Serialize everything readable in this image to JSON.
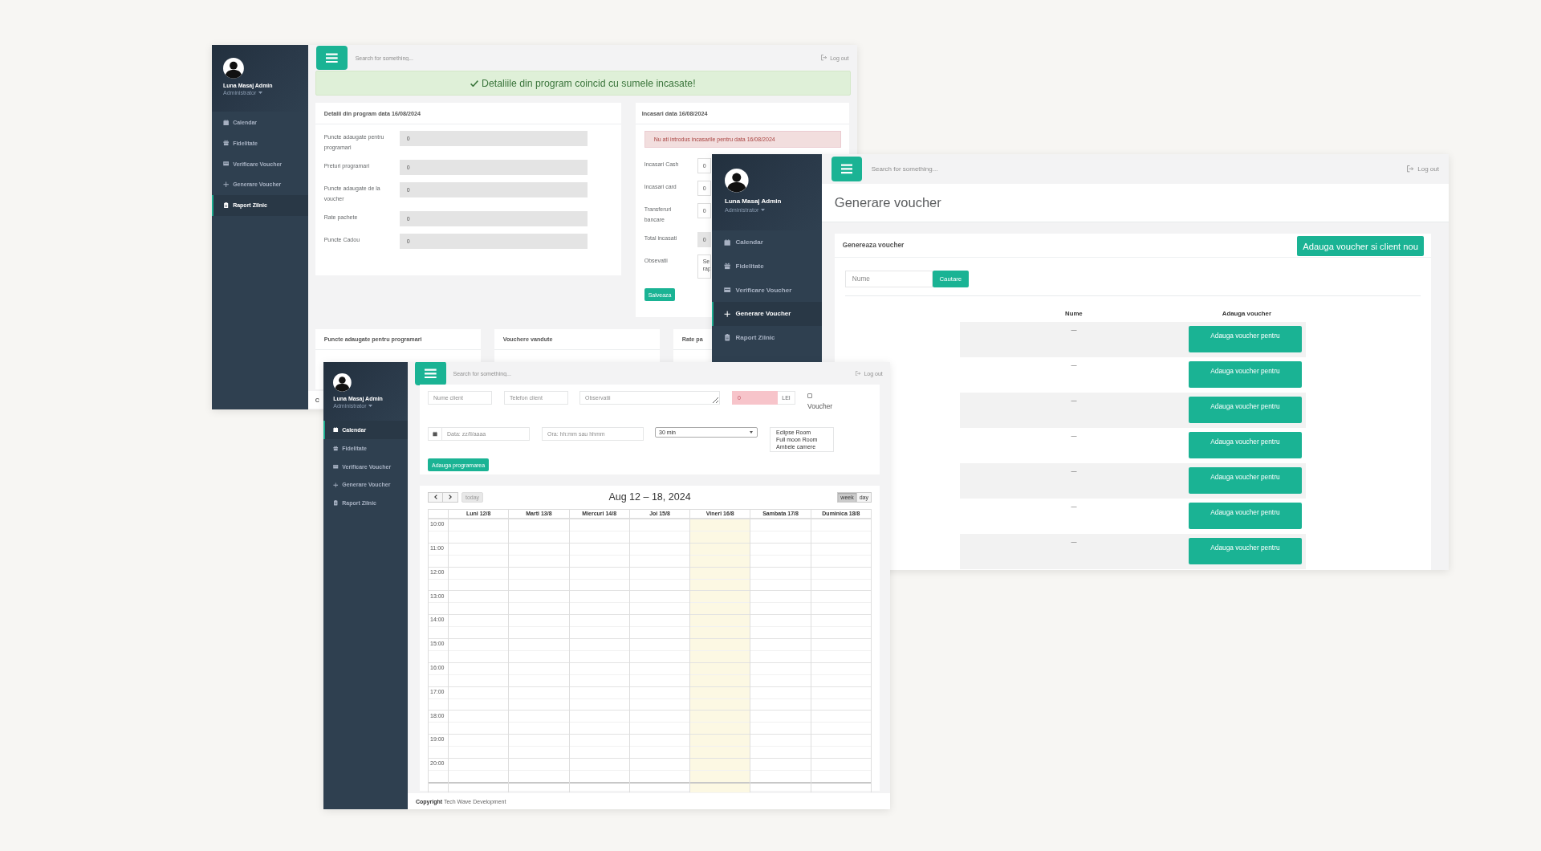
{
  "report_window": {
    "sidebar": {
      "user": "Luna Masaj Admin",
      "role": "Administrator",
      "items": [
        {
          "label": "Calendar",
          "selected": false
        },
        {
          "label": "Fidelitate",
          "selected": false
        },
        {
          "label": "Verificare Voucher",
          "selected": false
        },
        {
          "label": "Generare Voucher",
          "selected": false
        },
        {
          "label": "Raport Zilnic",
          "selected": true
        }
      ]
    },
    "topbar": {
      "search": {
        "placeholder": "Search for something..."
      },
      "logout": "Log out"
    },
    "success_alert": "Detaliile din program coincid cu sumele incasate!",
    "program_card": {
      "title": "Detalii din program data 16/08/2024",
      "fields": [
        {
          "label": "Puncte adaugate pentru programari",
          "value": "0",
          "disabled": true
        },
        {
          "label": "Preturi programari",
          "value": "0",
          "disabled": true
        },
        {
          "label": "Puncte adaugate de la voucher",
          "value": "0",
          "disabled": true
        },
        {
          "label": "Rate pachete",
          "value": "0",
          "disabled": true
        },
        {
          "label": "Puncte Cadou",
          "value": "0",
          "disabled": true
        }
      ]
    },
    "income_card": {
      "title": "Incasari data 16/08/2024",
      "error_alert": "Nu ati introdus incasarile pentru data 16/08/2024",
      "fields": [
        {
          "kind": "input",
          "label": "Incasari Cash",
          "value": "0",
          "disabled": false
        },
        {
          "kind": "input",
          "label": "Incasari card",
          "value": "0",
          "disabled": false
        },
        {
          "kind": "input",
          "label": "Transferuri bancare",
          "value": "0",
          "disabled": false
        },
        {
          "kind": "input",
          "label": "Total incasati",
          "value": "0",
          "disabled": true
        },
        {
          "kind": "textarea",
          "label": "Obsevatii",
          "value": "Se\nrap",
          "disabled": false
        }
      ],
      "save_button": "Salveaza"
    },
    "summary_cards": [
      {
        "title": "Puncte adaugate pentru programari"
      },
      {
        "title": "Vouchere vandute"
      },
      {
        "title": "Rate pa"
      }
    ],
    "footer": "C"
  },
  "voucher_window": {
    "sidebar": {
      "user": "Luna Masaj Admin",
      "role": "Administrator",
      "items": [
        {
          "label": "Calendar",
          "selected": false
        },
        {
          "label": "Fidelitate",
          "selected": false
        },
        {
          "label": "Verificare Voucher",
          "selected": false
        },
        {
          "label": "Generare Voucher",
          "selected": true
        },
        {
          "label": "Raport Zilnic",
          "selected": false
        }
      ]
    },
    "topbar": {
      "search": {
        "placeholder": "Search for something..."
      },
      "logout": "Log out"
    },
    "page_title": "Generare voucher",
    "card": {
      "title": "Genereaza voucher",
      "new_button": "Adauga voucher si client nou",
      "search": {
        "placeholder": "Nume"
      },
      "search_button": "Cautare",
      "table": {
        "columns": [
          "Nume",
          "Adauga voucher"
        ],
        "rows": [
          {
            "name": "—",
            "action": "Adauga voucher pentru"
          },
          {
            "name": "—",
            "action": "Adauga voucher pentru"
          },
          {
            "name": "—",
            "action": "Adauga voucher pentru"
          },
          {
            "name": "—",
            "action": "Adauga voucher pentru"
          },
          {
            "name": "—",
            "action": "Adauga voucher pentru"
          },
          {
            "name": "—",
            "action": "Adauga voucher pentru"
          },
          {
            "name": "—",
            "action": "Adauga voucher pentru"
          }
        ]
      }
    }
  },
  "calendar_window": {
    "sidebar": {
      "user": "Luna Masaj Admin",
      "role": "Administrator",
      "items": [
        {
          "label": "Calendar",
          "selected": true
        },
        {
          "label": "Fidelitate",
          "selected": false
        },
        {
          "label": "Verificare Voucher",
          "selected": false
        },
        {
          "label": "Generare Voucher",
          "selected": false
        },
        {
          "label": "Raport Zilnic",
          "selected": false
        }
      ]
    },
    "topbar": {
      "search": {
        "placeholder": "Search for something..."
      },
      "logout": "Log out"
    },
    "booking_form": {
      "client_name": {
        "placeholder": "Nume client"
      },
      "client_phone": {
        "placeholder": "Telefon client"
      },
      "notes": {
        "placeholder": "Observatii"
      },
      "price": {
        "value": "0",
        "invalid": true
      },
      "currency": "LEI",
      "voucher": {
        "label": "Voucher",
        "checked": false
      },
      "date": {
        "placeholder": "Data: zz/ll/aaaa"
      },
      "time": {
        "placeholder": "Ora: hh:mm sau hhmm"
      },
      "duration": {
        "value": "30 min"
      },
      "rooms": [
        {
          "label": "Eclipse Room",
          "selected": false
        },
        {
          "label": "Full moon Room",
          "selected": false
        },
        {
          "label": "Ambele camere",
          "selected": false
        }
      ],
      "submit_button": "Adauga programarea"
    },
    "calendar": {
      "title": "Aug 12 – 18, 2024",
      "today_button": {
        "label": "today",
        "disabled": true
      },
      "views": [
        {
          "label": "week",
          "selected": true
        },
        {
          "label": "day",
          "selected": false
        }
      ],
      "days": [
        {
          "label": "Luni 12/8",
          "today": false
        },
        {
          "label": "Marti 13/8",
          "today": false
        },
        {
          "label": "Miercuri 14/8",
          "today": false
        },
        {
          "label": "Joi 15/8",
          "today": false
        },
        {
          "label": "Vineri 16/8",
          "today": true
        },
        {
          "label": "Sambata 17/8",
          "today": false
        },
        {
          "label": "Duminica 18/8",
          "today": false
        }
      ],
      "times": [
        "10:00",
        "11:00",
        "12:00",
        "13:00",
        "14:00",
        "15:00",
        "16:00",
        "17:00",
        "18:00",
        "19:00",
        "20:00"
      ]
    },
    "footer": "**Copyright** Tech Wave Development"
  }
}
